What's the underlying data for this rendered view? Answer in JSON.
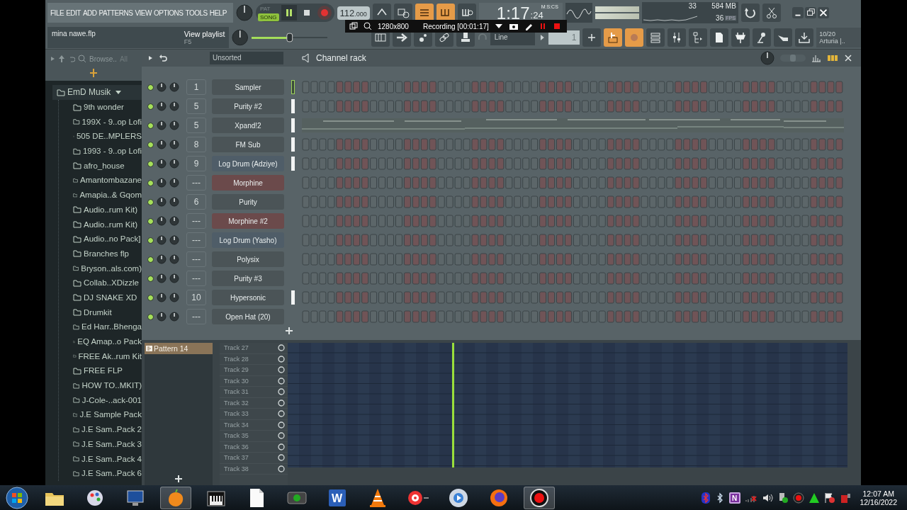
{
  "menu": [
    "FILE",
    "EDIT",
    "ADD",
    "PATTERNS",
    "VIEW",
    "OPTIONS",
    "TOOLS",
    "HELP"
  ],
  "hint": {
    "title": "mina nawe.flp",
    "text": "View playlist",
    "shortcut": "F5"
  },
  "transport": {
    "modes": [
      {
        "label": "PAT",
        "selected": false
      },
      {
        "label": "SONG",
        "selected": true
      }
    ],
    "playing": true,
    "tempo": "112",
    "tempo_decimals": ".000"
  },
  "recorder": {
    "size": "1280x800",
    "status": "Recording [00:01:17]"
  },
  "time": {
    "main": "1:17",
    "small": ":24",
    "unit": "M:S:CS"
  },
  "stats": {
    "cpu": "33",
    "memory": "584 MB",
    "fps": "36",
    "fps_label": "FPS"
  },
  "pitch": {
    "level": 0.5
  },
  "swing": {
    "level": 0.5
  },
  "snap": "Line",
  "pattern_number": "1",
  "plugin": {
    "count": "10/20",
    "name": "Arturia |.."
  },
  "browser": {
    "label": "Browse..",
    "filter": "All",
    "tree": [
      {
        "name": "EmD Musik",
        "expanded": true,
        "children": [
          {
            "name": "9th wonder"
          },
          {
            "name": "199X - 9..op Lofi"
          },
          {
            "name": "505 DE..MPLERS"
          },
          {
            "name": "1993 - 9..op Lofi"
          },
          {
            "name": "afro_house"
          },
          {
            "name": "Amantombazane"
          },
          {
            "name": "Amapia..& Gqom"
          },
          {
            "name": "Audio..rum Kit)"
          },
          {
            "name": "Audio..rum Kit)"
          },
          {
            "name": "Audio..no Pack]"
          },
          {
            "name": "Branches flp"
          },
          {
            "name": "Bryson..als.com)"
          },
          {
            "name": "Collab..XDizzle"
          },
          {
            "name": "DJ SNAKE XD"
          },
          {
            "name": "Drumkit"
          },
          {
            "name": "Ed Harr..Bhenga"
          },
          {
            "name": "EQ Amap..o Pack"
          },
          {
            "name": "FREE Ak..rum Kit"
          },
          {
            "name": "FREE FLP"
          },
          {
            "name": "HOW TO..MKIT)"
          },
          {
            "name": "J-Cole-..ack-001"
          },
          {
            "name": "J.E Sample Pack"
          },
          {
            "name": "J.E Sam..Pack 2"
          },
          {
            "name": "J.E Sam..Pack 3"
          },
          {
            "name": "J.E Sam..Pack 4"
          },
          {
            "name": "J.E Sam..Pack 6"
          }
        ]
      }
    ]
  },
  "channel_rack": {
    "title": "Channel rack",
    "filter": "Unsorted",
    "channels": [
      {
        "name": "Sampler",
        "number": "1",
        "on": true,
        "color": "#4b5457",
        "selected": true,
        "lit": false,
        "kind": "steps"
      },
      {
        "name": "Purity #2",
        "number": "5",
        "on": true,
        "color": "#4b5457",
        "selected": false,
        "lit": true,
        "kind": "steps"
      },
      {
        "name": "Xpand!2",
        "number": "5",
        "on": true,
        "color": "#4b5457",
        "selected": false,
        "lit": true,
        "kind": "pianoroll"
      },
      {
        "name": "FM Sub",
        "number": "8",
        "on": true,
        "color": "#4b5457",
        "selected": false,
        "lit": true,
        "kind": "steps"
      },
      {
        "name": "Log Drum (Adziye)",
        "number": "9",
        "on": true,
        "color": "#4f5d68",
        "selected": false,
        "lit": true,
        "kind": "steps"
      },
      {
        "name": "Morphine",
        "number": "---",
        "on": true,
        "color": "#6b4a4b",
        "selected": false,
        "lit": false,
        "kind": "steps"
      },
      {
        "name": "Purity",
        "number": "6",
        "on": true,
        "color": "#4b5457",
        "selected": false,
        "lit": false,
        "kind": "steps"
      },
      {
        "name": "Morphine #2",
        "number": "---",
        "on": true,
        "color": "#6b4a4b",
        "selected": false,
        "lit": false,
        "kind": "steps"
      },
      {
        "name": "Log Drum (Yasho)",
        "number": "---",
        "on": true,
        "color": "#4f5d68",
        "selected": false,
        "lit": false,
        "kind": "steps"
      },
      {
        "name": "Polysix",
        "number": "---",
        "on": true,
        "color": "#4b5457",
        "selected": false,
        "lit": false,
        "kind": "steps"
      },
      {
        "name": "Purity #3",
        "number": "---",
        "on": true,
        "color": "#4b5457",
        "selected": false,
        "lit": false,
        "kind": "steps"
      },
      {
        "name": "Hypersonic",
        "number": "10",
        "on": true,
        "color": "#4b5457",
        "selected": false,
        "lit": true,
        "kind": "steps"
      },
      {
        "name": "Open Hat (20)",
        "number": "---",
        "on": true,
        "color": "#4b5457",
        "selected": false,
        "lit": false,
        "kind": "steps"
      }
    ]
  },
  "playlist": {
    "patterns": [
      {
        "name": "Pattern 14",
        "selected": true
      }
    ],
    "tracks": [
      "Track 27",
      "Track 28",
      "Track 29",
      "Track 30",
      "Track 31",
      "Track 32",
      "Track 33",
      "Track 34",
      "Track 35",
      "Track 36",
      "Track 37",
      "Track 38"
    ]
  },
  "taskbar": {
    "apps": [
      {
        "kind": "explorer",
        "active": false
      },
      {
        "kind": "paint",
        "active": false
      },
      {
        "kind": "monitor",
        "active": false
      },
      {
        "kind": "fl",
        "active": true
      },
      {
        "kind": "piano",
        "active": false
      },
      {
        "kind": "document",
        "active": false
      },
      {
        "kind": "media",
        "active": false
      },
      {
        "kind": "word",
        "active": false,
        "glyph": "W"
      },
      {
        "kind": "cone",
        "active": false
      },
      {
        "kind": "target",
        "active": false
      },
      {
        "kind": "disc",
        "active": false
      },
      {
        "kind": "firefox",
        "active": false
      },
      {
        "kind": "recorder",
        "active": true
      }
    ],
    "tray": [
      {
        "kind": "bluetooth-red"
      },
      {
        "kind": "bluetooth"
      },
      {
        "kind": "note",
        "glyph": "N"
      },
      {
        "kind": "network"
      },
      {
        "kind": "volume"
      },
      {
        "kind": "usb"
      },
      {
        "kind": "record"
      },
      {
        "kind": "triangle"
      },
      {
        "kind": "flag"
      },
      {
        "kind": "power"
      }
    ],
    "time": "12:07 AM",
    "date": "12/16/2022"
  }
}
